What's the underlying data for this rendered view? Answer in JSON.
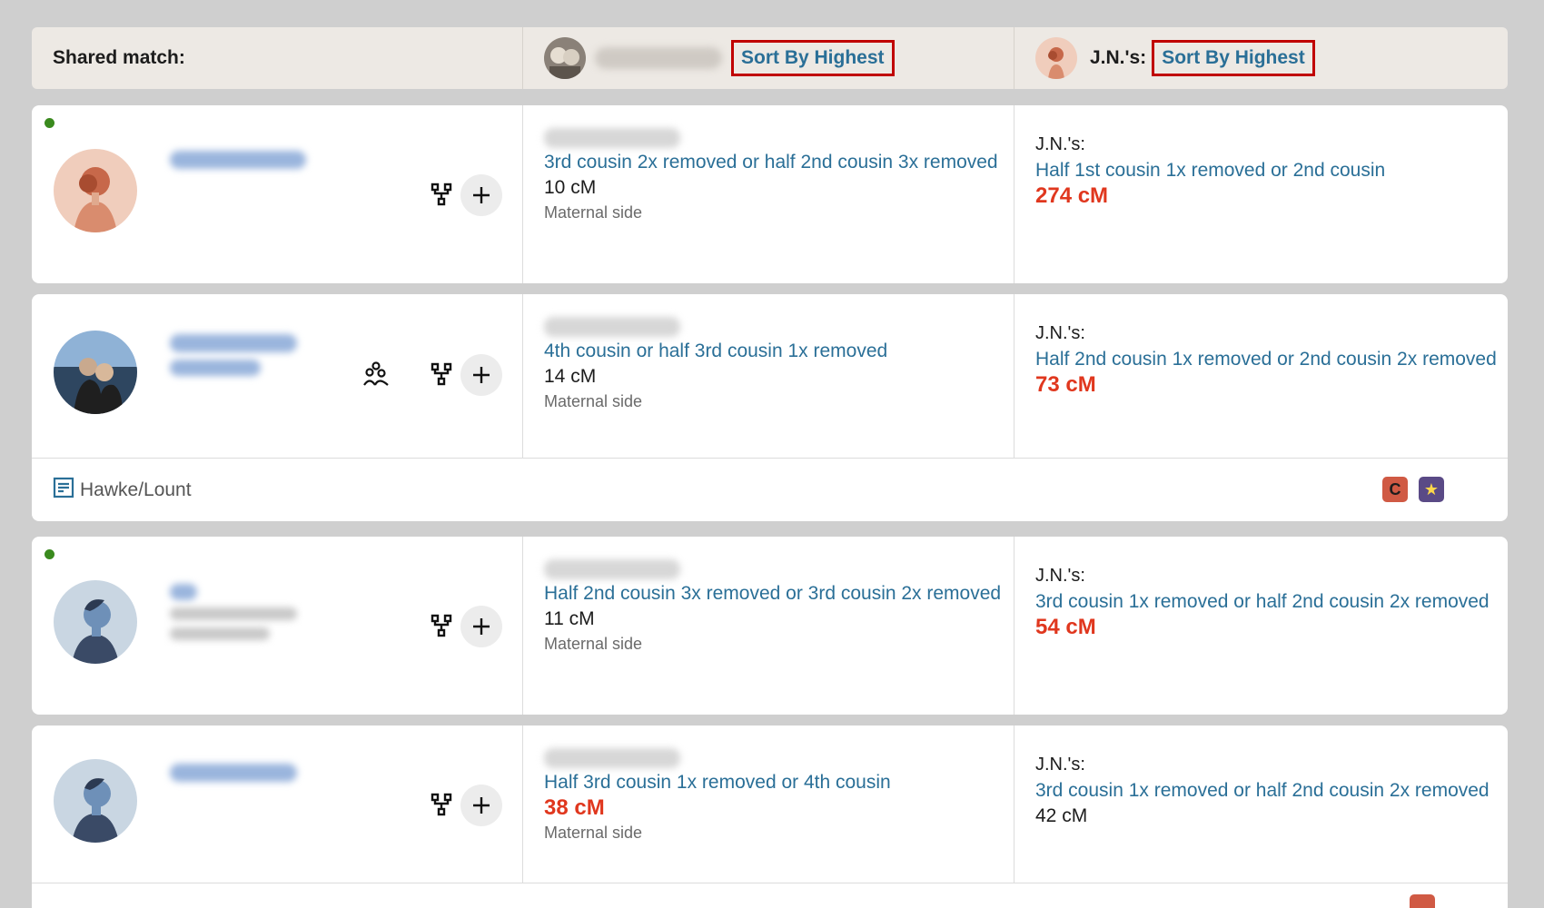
{
  "header": {
    "shared_match_label": "Shared match:",
    "col2_sort_label": "Sort By Highest",
    "col3_name": "J.N.'s:",
    "col3_sort_label": "Sort By Highest"
  },
  "matches": [
    {
      "col2": {
        "relationship": "3rd cousin 2x removed or half 2nd cousin 3x removed",
        "cm": "10 cM",
        "side": "Maternal side"
      },
      "col3": {
        "label": "J.N.'s:",
        "relationship": "Half 1st cousin 1x removed or 2nd cousin",
        "cm": "274 cM"
      }
    },
    {
      "col2": {
        "relationship": "4th cousin or half 3rd cousin 1x removed",
        "cm": "14 cM",
        "side": "Maternal side"
      },
      "col3": {
        "label": "J.N.'s:",
        "relationship": "Half 2nd cousin 1x removed or 2nd cousin 2x removed",
        "cm": "73 cM"
      },
      "note": "Hawke/Lount",
      "tags": {
        "c": "C",
        "star": "★"
      }
    },
    {
      "col2": {
        "relationship": "Half 2nd cousin 3x removed or 3rd cousin 2x removed",
        "cm": "11 cM",
        "side": "Maternal side"
      },
      "col3": {
        "label": "J.N.'s:",
        "relationship": "3rd cousin 1x removed or half 2nd cousin 2x removed",
        "cm": "54 cM"
      }
    },
    {
      "col2": {
        "relationship": "Half 3rd cousin 1x removed or 4th cousin",
        "cm": "38 cM",
        "side": "Maternal side"
      },
      "col3": {
        "label": "J.N.'s:",
        "relationship": "3rd cousin 1x removed or half 2nd cousin 2x removed",
        "cm": "42 cM"
      }
    }
  ],
  "colors": {
    "link": "#2a6f97",
    "highlight_cm": "#e0371e",
    "sort_border": "#c00000",
    "online": "#3a8a1e"
  }
}
